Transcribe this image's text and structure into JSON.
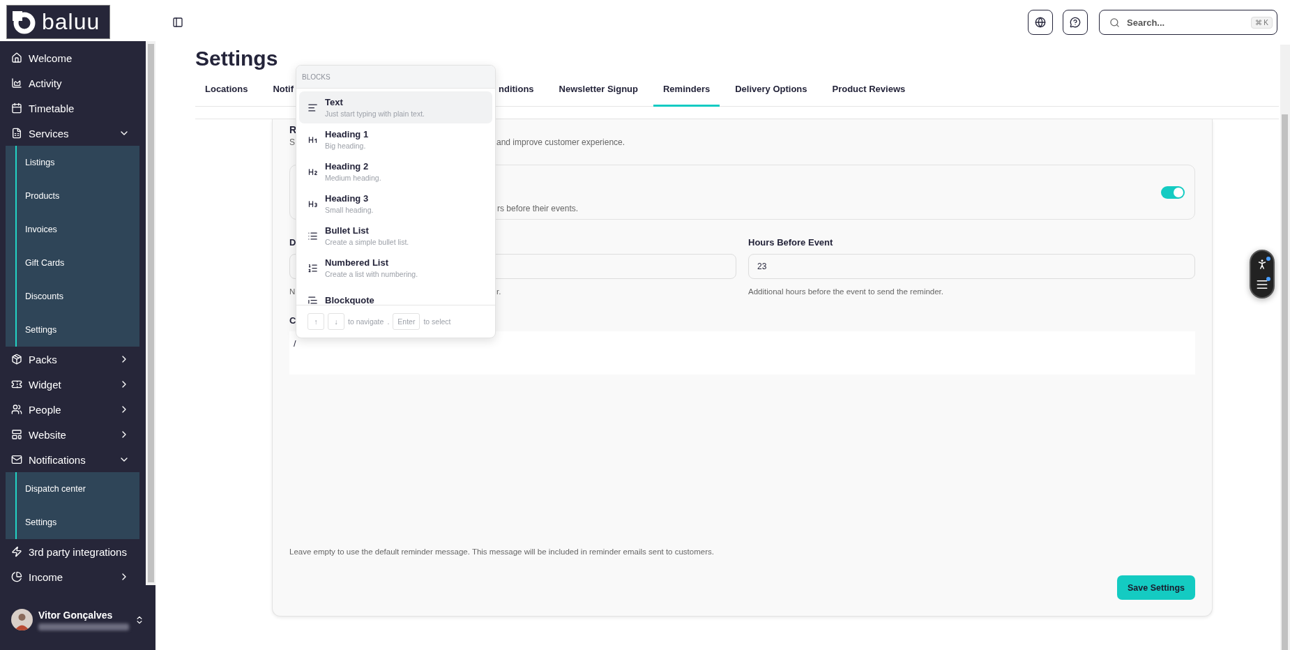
{
  "sidebar": {
    "logo": "baluu",
    "items": [
      {
        "label": "Welcome"
      },
      {
        "label": "Activity"
      },
      {
        "label": "Timetable"
      },
      {
        "label": "Services",
        "expanded": true,
        "children": [
          {
            "label": "Listings"
          },
          {
            "label": "Products"
          },
          {
            "label": "Invoices"
          },
          {
            "label": "Gift Cards"
          },
          {
            "label": "Discounts"
          },
          {
            "label": "Settings"
          }
        ]
      },
      {
        "label": "Packs",
        "expanded": false
      },
      {
        "label": "Widget",
        "expanded": false
      },
      {
        "label": "People",
        "expanded": false
      },
      {
        "label": "Website",
        "expanded": false
      },
      {
        "label": "Notifications",
        "expanded": true,
        "children": [
          {
            "label": "Dispatch center"
          },
          {
            "label": "Settings"
          }
        ]
      },
      {
        "label": "3rd party integrations"
      },
      {
        "label": "Income",
        "expanded": false
      }
    ],
    "user": {
      "name": "Vitor Gonçalves"
    }
  },
  "topbar": {
    "search": {
      "placeholder": "Search...",
      "shortcut": "⌘ K"
    }
  },
  "page": {
    "title": "Settings",
    "tabs": [
      {
        "label": "Locations",
        "selected": false
      },
      {
        "label": "Notif",
        "selected": false
      },
      {
        "label": "nditions",
        "selected": false
      },
      {
        "label": "Newsletter Signup",
        "selected": false
      },
      {
        "label": "Reminders",
        "selected": true
      },
      {
        "label": "Delivery Options",
        "selected": false
      },
      {
        "label": "Product Reviews",
        "selected": false
      }
    ]
  },
  "section": {
    "title": "R",
    "description_start": "S",
    "description_end": "and improve customer experience.",
    "toggle_card": {
      "description_end": "rs before their events.",
      "on": true
    },
    "fields": [
      {
        "label": "D",
        "hint_start": "N",
        "hint_end": "r."
      },
      {
        "label": "Hours Before Event",
        "value": "23",
        "hint": "Additional hours before the event to send the reminder."
      }
    ],
    "message": {
      "label": "C",
      "content": "/",
      "hint": "Leave empty to use the default reminder message. This message will be included in reminder emails sent to customers."
    },
    "save_button": "Save Settings"
  },
  "block_menu": {
    "heading": "BLOCKS",
    "items": [
      {
        "title": "Text",
        "description": "Just start typing with plain text.",
        "selected": true
      },
      {
        "title": "Heading 1",
        "description": "Big heading.",
        "selected": false
      },
      {
        "title": "Heading 2",
        "description": "Medium heading.",
        "selected": false
      },
      {
        "title": "Heading 3",
        "description": "Small heading.",
        "selected": false
      },
      {
        "title": "Bullet List",
        "description": "Create a simple bullet list.",
        "selected": false
      },
      {
        "title": "Numbered List",
        "description": "Create a list with numbering.",
        "selected": false
      },
      {
        "title": "Blockquote",
        "selected": false
      }
    ],
    "footer": {
      "keys": [
        "↑",
        "↓"
      ],
      "navigate": "to navigate",
      "separator": ".",
      "enter": "Enter",
      "select": "to select"
    }
  }
}
